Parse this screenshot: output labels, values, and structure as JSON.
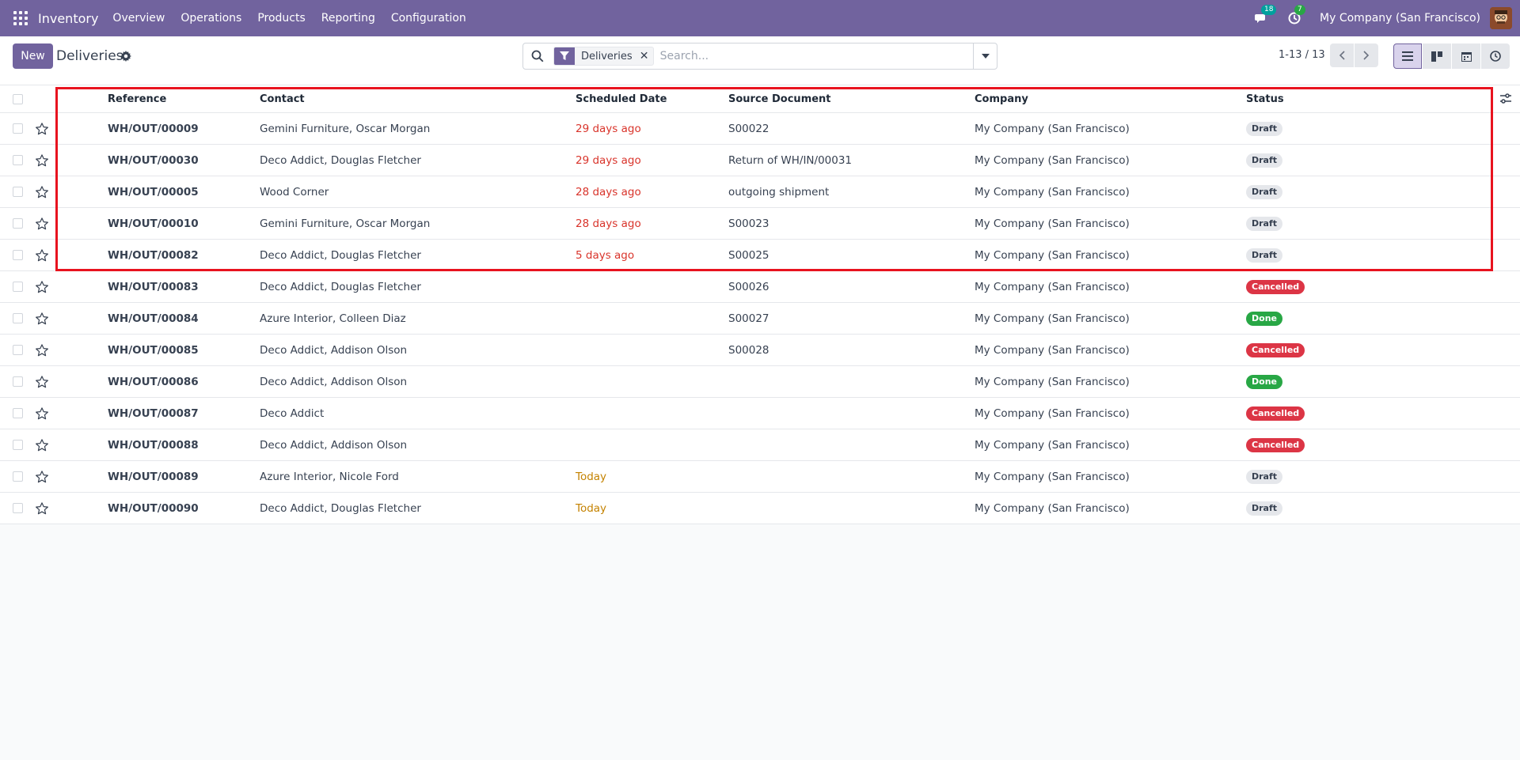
{
  "navbar": {
    "brand": "Inventory",
    "menu": [
      "Overview",
      "Operations",
      "Products",
      "Reporting",
      "Configuration"
    ],
    "messages_count": "18",
    "activities_count": "7",
    "company": "My Company (San Francisco)"
  },
  "control_panel": {
    "new_label": "New",
    "title": "Deliveries",
    "search": {
      "facet": "Deliveries",
      "placeholder": "Search..."
    },
    "pager": "1-13 / 13"
  },
  "list": {
    "columns": {
      "reference": "Reference",
      "contact": "Contact",
      "scheduled_date": "Scheduled Date",
      "source_document": "Source Document",
      "company": "Company",
      "status": "Status"
    },
    "rows": [
      {
        "reference": "WH/OUT/00009",
        "contact": "Gemini Furniture, Oscar Morgan",
        "scheduled_date": "29 days ago",
        "source_document": "S00022",
        "company": "My Company (San Francisco)",
        "status": "Draft"
      },
      {
        "reference": "WH/OUT/00030",
        "contact": "Deco Addict, Douglas Fletcher",
        "scheduled_date": "29 days ago",
        "source_document": "Return of WH/IN/00031",
        "company": "My Company (San Francisco)",
        "status": "Draft"
      },
      {
        "reference": "WH/OUT/00005",
        "contact": "Wood Corner",
        "scheduled_date": "28 days ago",
        "source_document": "outgoing shipment",
        "company": "My Company (San Francisco)",
        "status": "Draft"
      },
      {
        "reference": "WH/OUT/00010",
        "contact": "Gemini Furniture, Oscar Morgan",
        "scheduled_date": "28 days ago",
        "source_document": "S00023",
        "company": "My Company (San Francisco)",
        "status": "Draft"
      },
      {
        "reference": "WH/OUT/00082",
        "contact": "Deco Addict, Douglas Fletcher",
        "scheduled_date": "5 days ago",
        "source_document": "S00025",
        "company": "My Company (San Francisco)",
        "status": "Draft"
      },
      {
        "reference": "WH/OUT/00083",
        "contact": "Deco Addict, Douglas Fletcher",
        "scheduled_date": "",
        "source_document": "S00026",
        "company": "My Company (San Francisco)",
        "status": "Cancelled"
      },
      {
        "reference": "WH/OUT/00084",
        "contact": "Azure Interior, Colleen Diaz",
        "scheduled_date": "",
        "source_document": "S00027",
        "company": "My Company (San Francisco)",
        "status": "Done"
      },
      {
        "reference": "WH/OUT/00085",
        "contact": "Deco Addict, Addison Olson",
        "scheduled_date": "",
        "source_document": "S00028",
        "company": "My Company (San Francisco)",
        "status": "Cancelled"
      },
      {
        "reference": "WH/OUT/00086",
        "contact": "Deco Addict, Addison Olson",
        "scheduled_date": "",
        "source_document": "",
        "company": "My Company (San Francisco)",
        "status": "Done"
      },
      {
        "reference": "WH/OUT/00087",
        "contact": "Deco Addict",
        "scheduled_date": "",
        "source_document": "",
        "company": "My Company (San Francisco)",
        "status": "Cancelled"
      },
      {
        "reference": "WH/OUT/00088",
        "contact": "Deco Addict, Addison Olson",
        "scheduled_date": "",
        "source_document": "",
        "company": "My Company (San Francisco)",
        "status": "Cancelled"
      },
      {
        "reference": "WH/OUT/00089",
        "contact": "Azure Interior, Nicole Ford",
        "scheduled_date": "Today",
        "source_document": "",
        "company": "My Company (San Francisco)",
        "status": "Draft"
      },
      {
        "reference": "WH/OUT/00090",
        "contact": "Deco Addict, Douglas Fletcher",
        "scheduled_date": "Today",
        "source_document": "",
        "company": "My Company (San Francisco)",
        "status": "Draft"
      }
    ]
  },
  "colors": {
    "brand": "#71639e",
    "overdue": "#d9342b",
    "today": "#c48200",
    "cancelled": "#dc3545",
    "done": "#28a745",
    "highlight": "#e8131f"
  }
}
